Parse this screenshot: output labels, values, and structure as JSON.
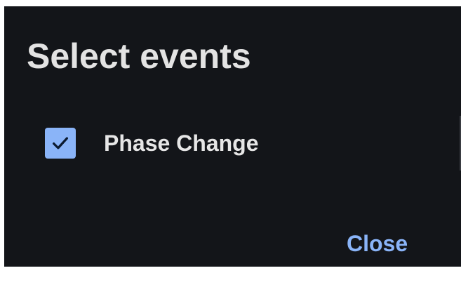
{
  "dialog": {
    "title": "Select events",
    "events": [
      {
        "label": "Phase Change",
        "checked": true
      }
    ],
    "close_label": "Close"
  },
  "colors": {
    "background": "#131519",
    "title_text": "#e3e3e3",
    "checkbox_fill": "#8ab4f8",
    "checkmark": "#0b1a30",
    "accent": "#8ab4f8"
  },
  "icons": {
    "checkbox": "check-icon"
  }
}
